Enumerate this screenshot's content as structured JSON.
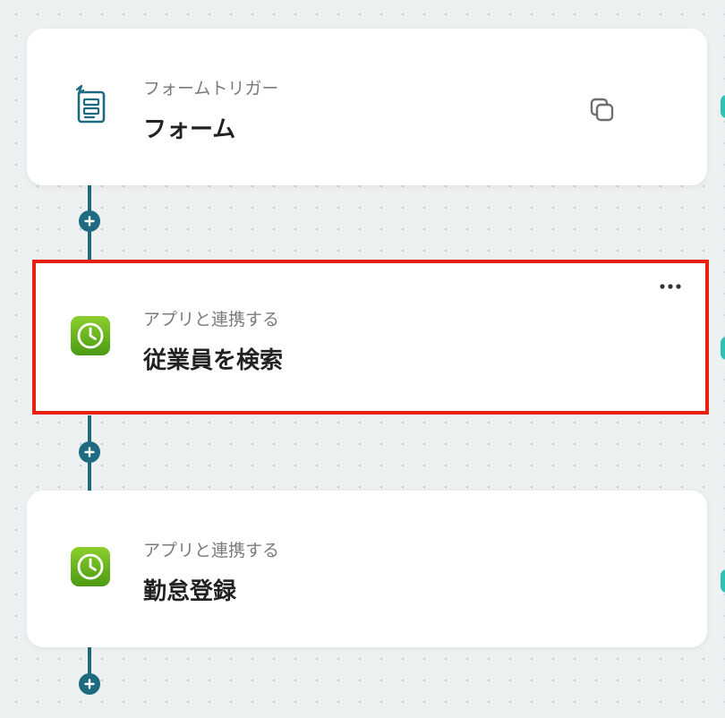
{
  "steps": [
    {
      "id": "trigger",
      "category": "フォームトリガー",
      "title": "フォーム",
      "icon": "form-icon",
      "action_icon": "copy-icon"
    },
    {
      "id": "search-employee",
      "category": "アプリと連携する",
      "title": "従業員を検索",
      "icon": "clock-app-icon",
      "action_icon": "more-icon",
      "selected": true
    },
    {
      "id": "attendance",
      "category": "アプリと連携する",
      "title": "勤怠登録",
      "icon": "clock-app-icon"
    }
  ],
  "colors": {
    "connector": "#1e6a80",
    "selection_border": "#e8200f",
    "app_icon_green": "#5cab1b",
    "form_icon": "#1e6a80",
    "edge_marker": "#2cc3b5"
  }
}
